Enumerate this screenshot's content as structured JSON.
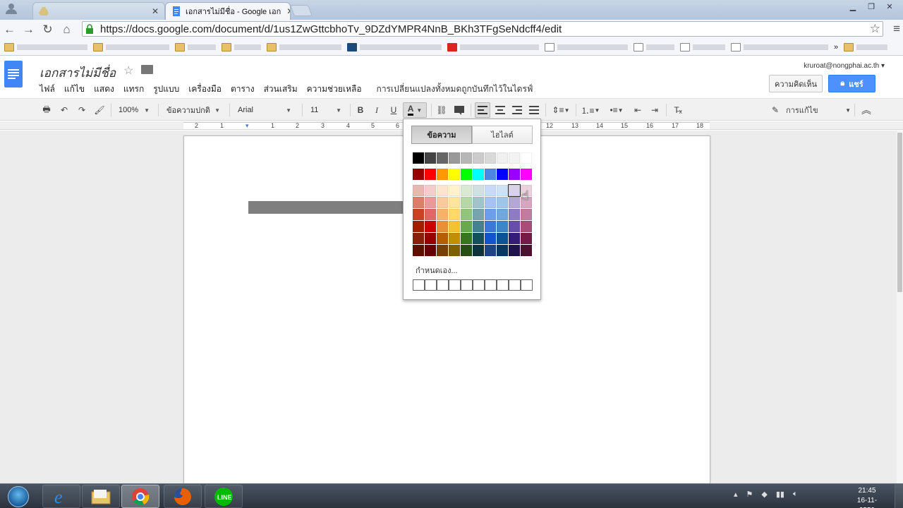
{
  "browser": {
    "tabs": [
      {
        "label": "",
        "active": false
      },
      {
        "label": "เอกสารไม่มีชื่อ - Google เอก",
        "active": true
      }
    ],
    "url": "https://docs.google.com/document/d/1us1ZwGttcbhoTv_9DZdYMPR4NnB_BKh3TFgSeNdcff4/edit",
    "bookmarks": [
      {
        "label": "",
        "type": "folder"
      },
      {
        "label": "",
        "type": "folder"
      },
      {
        "label": "",
        "type": "folder"
      },
      {
        "label": "",
        "type": "folder"
      },
      {
        "label": "",
        "type": "folder"
      },
      {
        "label": "",
        "type": "page"
      },
      {
        "label": "",
        "type": "youtube"
      },
      {
        "label": "",
        "type": "page"
      },
      {
        "label": "",
        "type": "page"
      },
      {
        "label": "",
        "type": "page"
      },
      {
        "label": "",
        "type": "page"
      }
    ]
  },
  "docs": {
    "title": "เอกสารไม่มีชื่อ",
    "account": "kruroat@nongphai.ac.th",
    "menus": [
      "ไฟล์",
      "แก้ไข",
      "แสดง",
      "แทรก",
      "รูปแบบ",
      "เครื่องมือ",
      "ตาราง",
      "ส่วนเสริม",
      "ความช่วยเหลือ"
    ],
    "save_status": "การเปลี่ยนแปลงทั้งหมดถูกบันทึกไว้ในไดรฟ์",
    "comments_label": "ความคิดเห็น",
    "share_label": "แชร์",
    "toolbar": {
      "zoom": "100%",
      "style": "ข้อความปกติ",
      "font": "Arial",
      "size": "11",
      "bold": "B",
      "italic": "I",
      "underline": "U",
      "text_color": "A",
      "mode": "การแก้ไข"
    },
    "ruler_numbers": [
      "2",
      "1",
      "1",
      "2",
      "3",
      "4",
      "5",
      "6",
      "12",
      "13",
      "14",
      "15",
      "16",
      "17",
      "18"
    ],
    "selected_text": ""
  },
  "color_popup": {
    "tab_text": "ข้อความ",
    "tab_highlight": "ไฮไลต์",
    "custom_label": "กำหนดเอง...",
    "grays": [
      "#000000",
      "#434343",
      "#666666",
      "#999999",
      "#b7b7b7",
      "#cccccc",
      "#d9d9d9",
      "#efefef",
      "#f3f3f3",
      "#ffffff"
    ],
    "brights": [
      "#980000",
      "#ff0000",
      "#ff9900",
      "#ffff00",
      "#00ff00",
      "#00ffff",
      "#4a86e8",
      "#0000ff",
      "#9900ff",
      "#ff00ff"
    ],
    "shades": [
      [
        "#e6b8af",
        "#f4cccc",
        "#fce5cd",
        "#fff2cc",
        "#d9ead3",
        "#d0e0e3",
        "#c9daf8",
        "#cfe2f3",
        "#d9d2e9",
        "#ead1dc"
      ],
      [
        "#dd7e6b",
        "#ea9999",
        "#f9cb9c",
        "#ffe599",
        "#b6d7a8",
        "#a2c4c9",
        "#a4c2f4",
        "#9fc5e8",
        "#b4a7d6",
        "#d5a6bd"
      ],
      [
        "#cc4125",
        "#e06666",
        "#f6b26b",
        "#ffd966",
        "#93c47d",
        "#76a5af",
        "#6d9eeb",
        "#6fa8dc",
        "#8e7cc3",
        "#c27ba0"
      ],
      [
        "#a61c00",
        "#cc0000",
        "#e69138",
        "#f1c232",
        "#6aa84f",
        "#45818e",
        "#3c78d8",
        "#3d85c6",
        "#674ea7",
        "#a64d79"
      ],
      [
        "#85200c",
        "#990000",
        "#b45f06",
        "#bf9000",
        "#38761d",
        "#134f5c",
        "#1155cc",
        "#0b5394",
        "#351c75",
        "#741b47"
      ],
      [
        "#5b0f00",
        "#660000",
        "#783f04",
        "#7f6000",
        "#274e13",
        "#0c343d",
        "#1c4587",
        "#073763",
        "#20124d",
        "#4c1130"
      ]
    ],
    "hovered": "#d9d2e9"
  },
  "taskbar": {
    "clock_time": "21:45",
    "clock_date": "16-11-2559"
  }
}
